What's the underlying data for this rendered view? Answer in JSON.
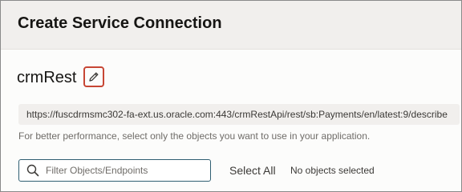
{
  "dialog": {
    "title": "Create Service Connection"
  },
  "connection": {
    "name": "crmRest",
    "edit_icon": "pencil-icon",
    "url": "https://fuscdrmsmc302-fa-ext.us.oracle.com:443/crmRestApi/rest/sb:Payments/en/latest:9/describe",
    "hint": "For better performance, select only the objects you want to use in your application."
  },
  "filter": {
    "search_icon": "search-icon",
    "placeholder": "Filter Objects/Endpoints",
    "value": "",
    "select_all_label": "Select All",
    "selection_status": "No objects selected"
  },
  "colors": {
    "edit_border": "#c74634",
    "search_border": "#2f5f72",
    "header_bg": "#f1efed"
  }
}
